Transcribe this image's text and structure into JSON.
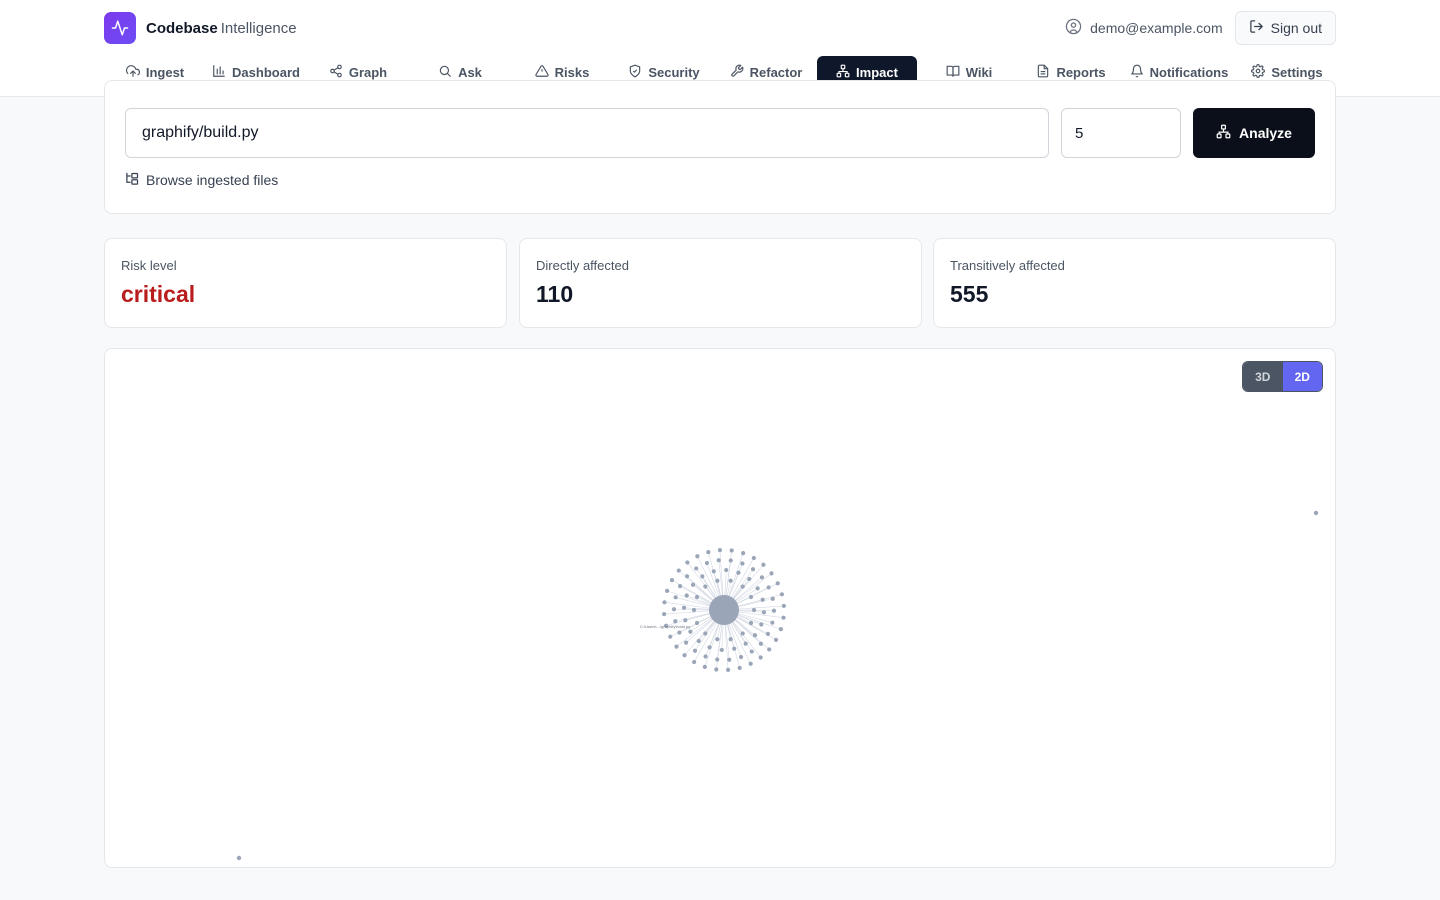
{
  "brand": {
    "name_bold": "Codebase",
    "name_light": "Intelligence",
    "logo_icon": "activity-icon"
  },
  "user": {
    "email": "demo@example.com",
    "signout_label": "Sign out"
  },
  "nav": {
    "items": [
      {
        "label": "Ingest",
        "icon": "cloud-upload-icon",
        "active": false
      },
      {
        "label": "Dashboard",
        "icon": "bar-chart-icon",
        "active": false
      },
      {
        "label": "Graph",
        "icon": "share-icon",
        "active": false
      },
      {
        "label": "Ask",
        "icon": "search-icon",
        "active": false
      },
      {
        "label": "Risks",
        "icon": "alert-triangle-icon",
        "active": false
      },
      {
        "label": "Security",
        "icon": "shield-icon",
        "active": false
      },
      {
        "label": "Refactor",
        "icon": "wrench-icon",
        "active": false
      },
      {
        "label": "Impact",
        "icon": "network-icon",
        "active": true
      },
      {
        "label": "Wiki",
        "icon": "book-icon",
        "active": false
      },
      {
        "label": "Reports",
        "icon": "file-text-icon",
        "active": false
      },
      {
        "label": "Notifications",
        "icon": "bell-icon",
        "active": false
      },
      {
        "label": "Settings",
        "icon": "gear-icon",
        "active": false
      }
    ]
  },
  "impact_form": {
    "file_value": "graphify/build.py",
    "depth_value": "5",
    "analyze_label": "Analyze",
    "browse_label": "Browse ingested files"
  },
  "stats": {
    "risk_label": "Risk level",
    "risk_value": "critical",
    "direct_label": "Directly affected",
    "direct_value": "110",
    "transitive_label": "Transitively affected",
    "transitive_value": "555"
  },
  "graph": {
    "toggle_3d": "3D",
    "toggle_2d": "2D",
    "mode": "2D",
    "center_label": "C:\\Users\\...\\graphify\\build.py",
    "node_color": "#9aa5b8",
    "link_color": "#d3d9e3"
  },
  "colors": {
    "accent": "#6366f1",
    "critical": "#b91c1c",
    "active_nav": "#0f172a"
  }
}
